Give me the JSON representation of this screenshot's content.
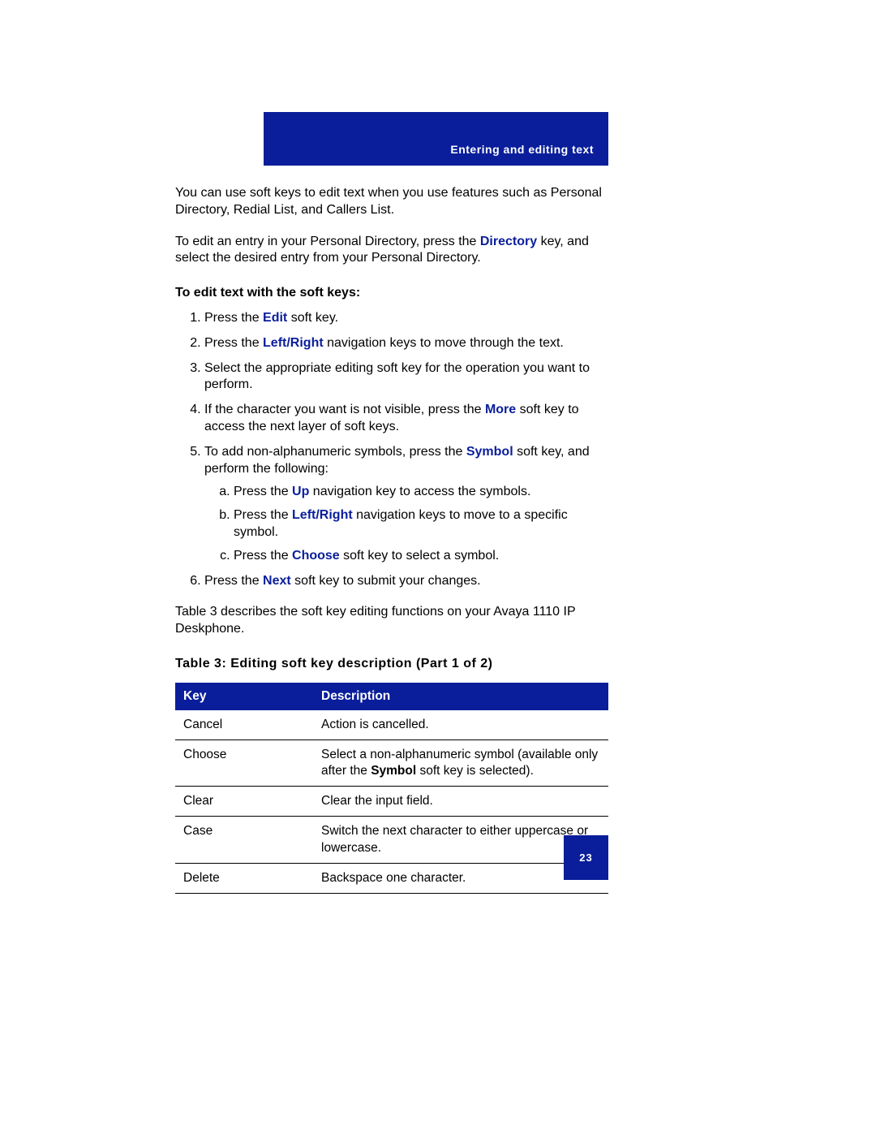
{
  "header": {
    "section_title": "Entering and editing text"
  },
  "para1": {
    "text": "You can use soft keys to edit text when you use features such as Personal Directory, Redial List, and Callers List."
  },
  "para2": {
    "pre": "To edit an entry in your Personal Directory, press the ",
    "key": "Directory",
    "post": " key, and select the desired entry from your Personal Directory."
  },
  "steps_heading": "To edit text with the soft keys:",
  "steps": {
    "s1": {
      "pre": "Press the ",
      "key": "Edit",
      "post": " soft key."
    },
    "s2": {
      "pre": "Press the ",
      "key": "Left/Right",
      "post": " navigation keys to move through the text."
    },
    "s3": {
      "text": "Select the appropriate editing soft key for the operation you want to perform."
    },
    "s4": {
      "pre": "If the character you want is not visible, press the ",
      "key": "More",
      "post": " soft key to access the next layer of soft keys."
    },
    "s5": {
      "pre": "To add non-alphanumeric symbols, press the ",
      "key": "Symbol",
      "post": " soft key, and perform the following:",
      "sub": {
        "a": {
          "pre": "Press the ",
          "key": "Up",
          "post": " navigation key to access the symbols."
        },
        "b": {
          "pre": "Press the ",
          "key": "Left/Right",
          "post": " navigation keys to move to a specific symbol."
        },
        "c": {
          "pre": "Press the ",
          "key": "Choose",
          "post": " soft key to select a symbol."
        }
      }
    },
    "s6": {
      "pre": "Press the ",
      "key": "Next",
      "post": " soft key to submit your changes."
    }
  },
  "para3": {
    "text": "Table 3 describes the soft key editing functions on your Avaya 1110 IP Deskphone."
  },
  "table": {
    "caption": "Table 3: Editing soft key description (Part 1 of 2)",
    "head": {
      "c1": "Key",
      "c2": "Description"
    },
    "rows": [
      {
        "key": "Cancel",
        "desc_pre": "Action is cancelled.",
        "bold": "",
        "desc_post": ""
      },
      {
        "key": "Choose",
        "desc_pre": "Select a non-alphanumeric symbol (available only after the ",
        "bold": "Symbol",
        "desc_post": " soft key is selected)."
      },
      {
        "key": "Clear",
        "desc_pre": "Clear the input field.",
        "bold": "",
        "desc_post": ""
      },
      {
        "key": "Case",
        "desc_pre": "Switch the next character to either uppercase or lowercase.",
        "bold": "",
        "desc_post": ""
      },
      {
        "key": "Delete",
        "desc_pre": "Backspace one character.",
        "bold": "",
        "desc_post": ""
      }
    ]
  },
  "page_number": "23"
}
